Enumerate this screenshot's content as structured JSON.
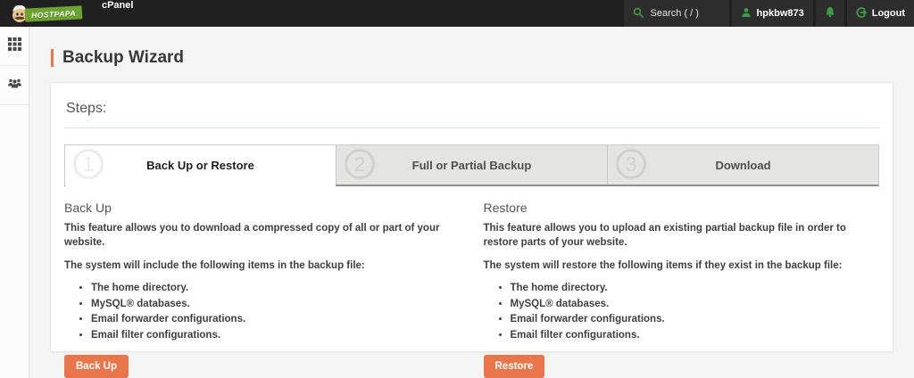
{
  "topbar": {
    "brand": "HOSTPAPA",
    "app_label": "cPanel",
    "search_placeholder": "Search ( / )",
    "username": "hpkbw873",
    "logout_label": "Logout"
  },
  "page": {
    "title": "Backup Wizard"
  },
  "card": {
    "steps_label": "Steps:",
    "steps": [
      {
        "number": "1",
        "label": "Back Up or Restore",
        "active": true
      },
      {
        "number": "2",
        "label": "Full or Partial Backup",
        "active": false
      },
      {
        "number": "3",
        "label": "Download",
        "active": false
      }
    ],
    "backup": {
      "heading": "Back Up",
      "description": "This feature allows you to download a compressed copy of all or part of your website.",
      "list_intro": "The system will include the following items in the backup file:",
      "items": [
        "The home directory.",
        "MySQL® databases.",
        "Email forwarder configurations.",
        "Email filter configurations."
      ],
      "button_label": "Back Up"
    },
    "restore": {
      "heading": "Restore",
      "description": "This feature allows you to upload an existing partial backup file in order to restore parts of your website.",
      "list_intro": "The system will restore the following items if they exist in the backup file:",
      "items": [
        "The home directory.",
        "MySQL® databases.",
        "Email forwarder configurations.",
        "Email filter configurations."
      ],
      "button_label": "Restore"
    }
  },
  "icons": {
    "search": "magnifying-glass",
    "user": "person-silhouette",
    "notifications": "bell",
    "logout": "power-arrow",
    "apps": "grid-3x3",
    "groups": "people-group"
  },
  "colors": {
    "topbar_bg": "#202020",
    "accent_orange": "#e8764a",
    "accent_green": "#3f9b41",
    "brand_green": "#6aa32f",
    "page_bg": "#f5f5f5"
  }
}
